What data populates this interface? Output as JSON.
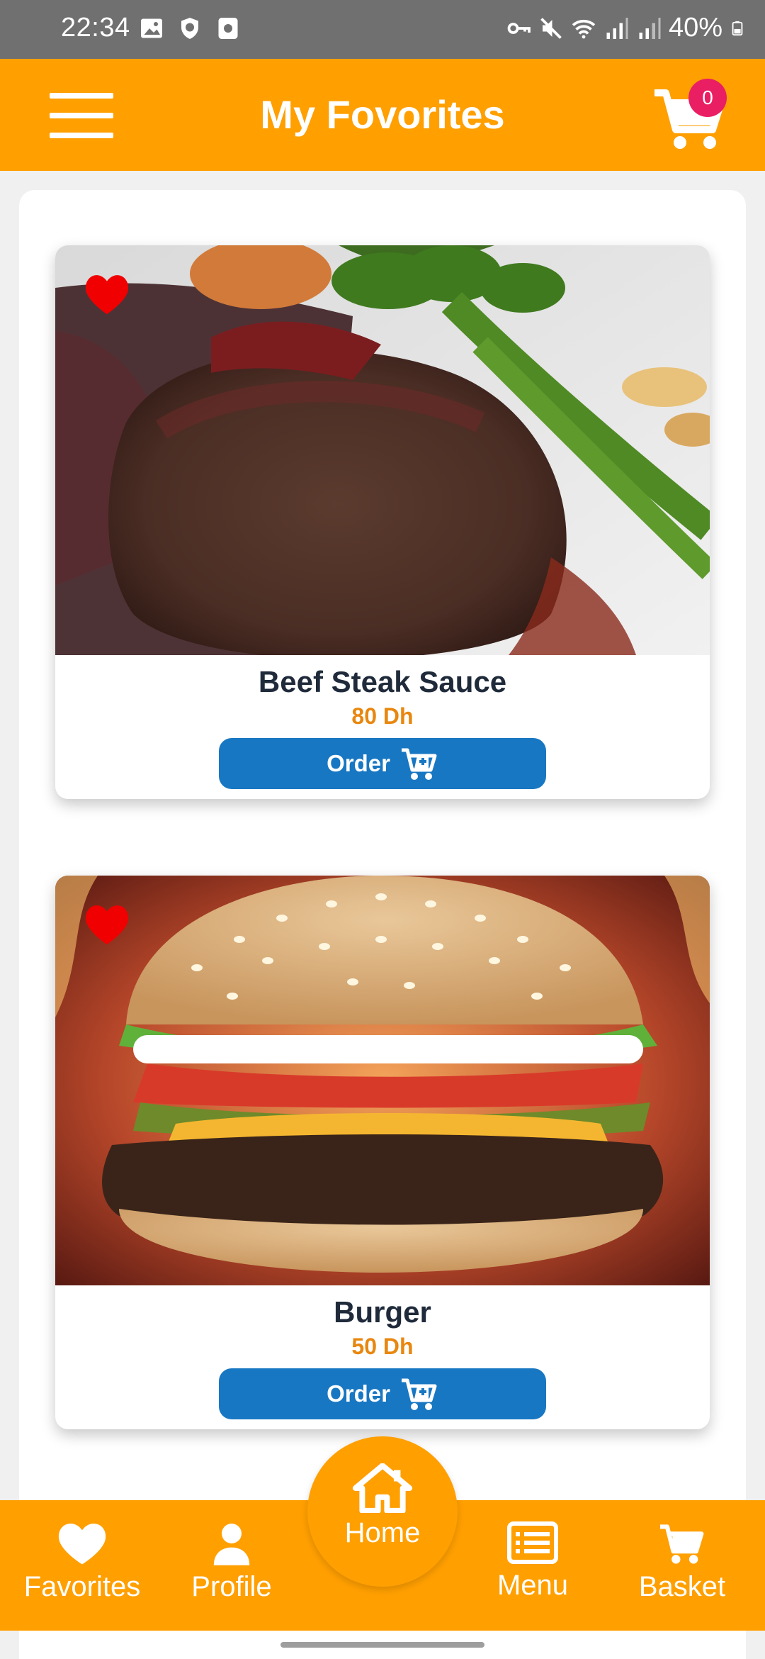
{
  "status_bar": {
    "time": "22:34",
    "battery": "40%",
    "left_icons": [
      "gallery-icon",
      "shield-icon",
      "screenshot-icon"
    ],
    "right_icons": [
      "vpn-key-icon",
      "mute-icon",
      "wifi-icon",
      "signal-icon",
      "signal-icon",
      "battery-icon"
    ]
  },
  "header": {
    "title": "My Fovorites",
    "cart_count": "0",
    "menu_icon": "hamburger-icon",
    "cart_icon": "cart-icon"
  },
  "favorites": [
    {
      "name": "Beef Steak Sauce",
      "price": "80 Dh",
      "order_label": "Order",
      "favorited": true
    },
    {
      "name": "Burger",
      "price": "50 Dh",
      "order_label": "Order",
      "favorited": true
    }
  ],
  "bottom_nav": {
    "favorites": "Favorites",
    "profile": "Profile",
    "home": "Home",
    "menu": "Menu",
    "basket": "Basket"
  },
  "colors": {
    "primary": "#ff9f00",
    "button": "#1877c2",
    "price": "#e8870f",
    "badge": "#e91e63",
    "heart": "#f00000"
  }
}
